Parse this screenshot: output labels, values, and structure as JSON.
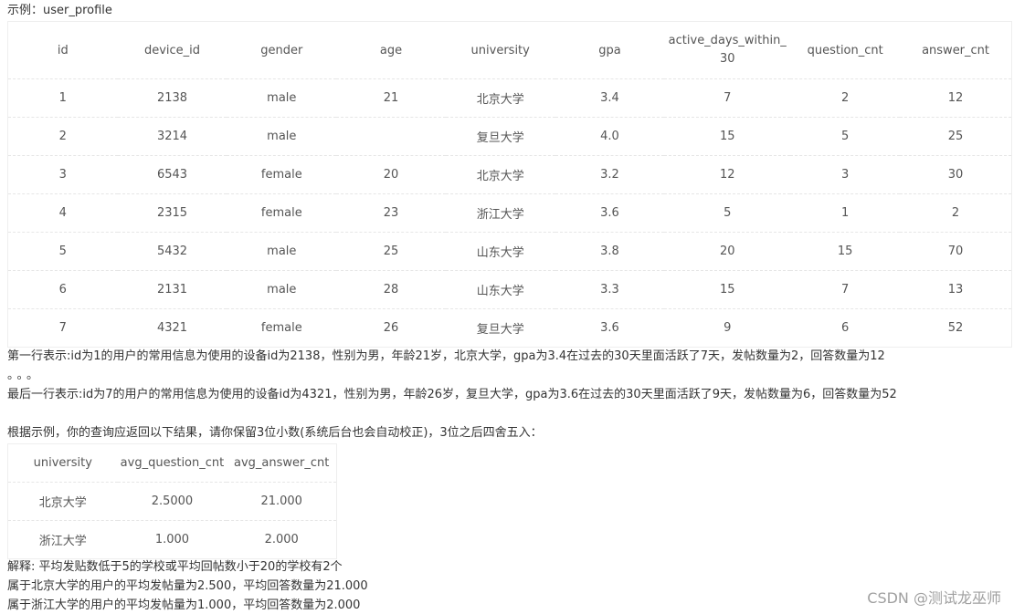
{
  "example_label": "示例：user_profile",
  "table": {
    "headers": [
      "id",
      "device_id",
      "gender",
      "age",
      "university",
      "gpa",
      "active_days_within_30",
      "question_cnt",
      "answer_cnt"
    ],
    "rows": [
      [
        "1",
        "2138",
        "male",
        "21",
        "北京大学",
        "3.4",
        "7",
        "2",
        "12"
      ],
      [
        "2",
        "3214",
        "male",
        "",
        "复旦大学",
        "4.0",
        "15",
        "5",
        "25"
      ],
      [
        "3",
        "6543",
        "female",
        "20",
        "北京大学",
        "3.2",
        "12",
        "3",
        "30"
      ],
      [
        "4",
        "2315",
        "female",
        "23",
        "浙江大学",
        "3.6",
        "5",
        "1",
        "2"
      ],
      [
        "5",
        "5432",
        "male",
        "25",
        "山东大学",
        "3.8",
        "20",
        "15",
        "70"
      ],
      [
        "6",
        "2131",
        "male",
        "28",
        "山东大学",
        "3.3",
        "15",
        "7",
        "13"
      ],
      [
        "7",
        "4321",
        "female",
        "26",
        "复旦大学",
        "3.6",
        "9",
        "6",
        "52"
      ]
    ]
  },
  "note_first_row": "第一行表示:id为1的用户的常用信息为使用的设备id为2138，性别为男，年龄21岁，北京大学，gpa为3.4在过去的30天里面活跃了7天，发帖数量为2，回答数量为12",
  "ellipsis": "。。。",
  "note_last_row": "最后一行表示:id为7的用户的常用信息为使用的设备id为4321，性别为男，年龄26岁，复旦大学，gpa为3.6在过去的30天里面活跃了9天，发帖数量为6，回答数量为52",
  "instruction": "根据示例，你的查询应返回以下结果，请你保留3位小数(系统后台也会自动校正)，3位之后四舍五入：",
  "result_table": {
    "headers": [
      "university",
      "avg_question_cnt",
      "avg_answer_cnt"
    ],
    "rows": [
      [
        "北京大学",
        "2.5000",
        "21.000"
      ],
      [
        "浙江大学",
        "1.000",
        "2.000"
      ]
    ]
  },
  "explanation": "解释: 平均发贴数低于5的学校或平均回帖数小于20的学校有2个",
  "explanation_pku": "属于北京大学的用户的平均发帖量为2.500，平均回答数量为21.000",
  "explanation_zju": "属于浙江大学的用户的平均发帖量为1.000，平均回答数量为2.000",
  "watermark": "CSDN @测试龙巫师"
}
